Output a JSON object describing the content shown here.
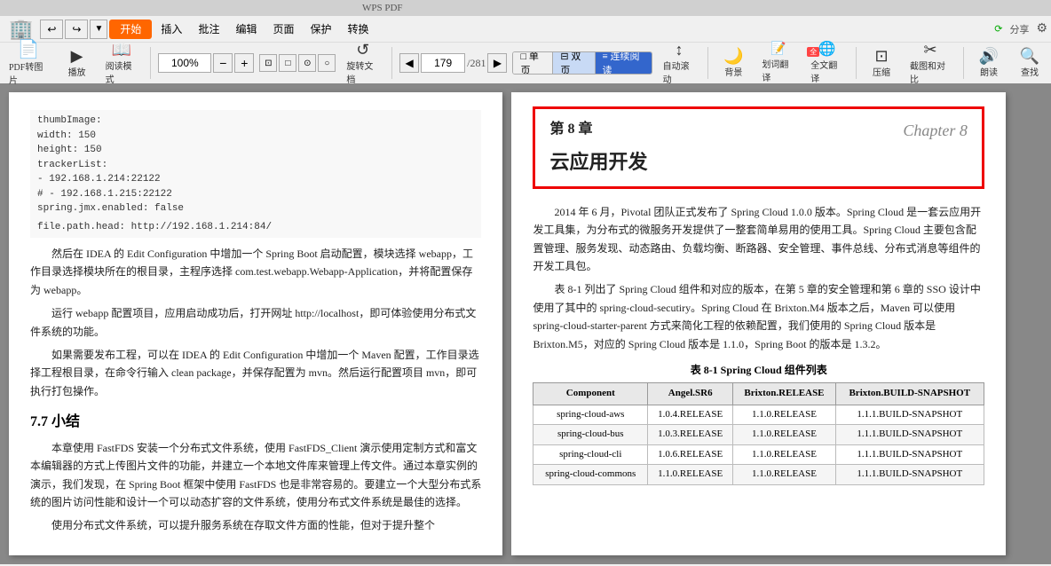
{
  "titlebar": {
    "text": ""
  },
  "toolbar": {
    "row1": {
      "buttons": [
        "↩",
        "↪",
        "▼"
      ],
      "start_label": "开始",
      "menus": [
        "插入",
        "批注",
        "编辑",
        "页面",
        "保护",
        "转换"
      ],
      "right_items": [
        "分享",
        "⚙"
      ]
    },
    "zoom": {
      "value": "100%",
      "total_pages": "281",
      "current_page": "179"
    },
    "buttons": [
      {
        "icon": "📄",
        "label": "PDF转图片"
      },
      {
        "icon": "▶",
        "label": "播放"
      },
      {
        "icon": "📖",
        "label": "阅读模式"
      },
      {
        "icon": "⊞",
        "label": ""
      },
      {
        "icon": "↺",
        "label": "旋转文档"
      },
      {
        "icon": "□",
        "label": "单页"
      },
      {
        "icon": "⊟",
        "label": "双页"
      },
      {
        "icon": "≡",
        "label": "连续阅读"
      },
      {
        "icon": "↕",
        "label": "自动滚动"
      },
      {
        "icon": "🌙",
        "label": "背景"
      },
      {
        "icon": "译",
        "label": "全文翻译"
      },
      {
        "icon": "⊡",
        "label": "压缩"
      },
      {
        "icon": "⊞",
        "label": "截图和对比"
      },
      {
        "icon": "🔊",
        "label": "朗读"
      },
      {
        "icon": "🔍",
        "label": "查找"
      },
      {
        "icon": "词",
        "label": "划词翻译"
      }
    ]
  },
  "left_page": {
    "code": [
      "  thumbImage:",
      "    width: 150",
      "    height: 150",
      "  trackerList:",
      "    - 192.168.1.214:22122",
      "#   - 192.168.1.215:22122",
      "spring.jmx.enabled: false",
      "",
      "file.path.head: http://192.168.1.214:84/"
    ],
    "paragraphs": [
      "然后在 IDEA 的 Edit Configuration 中增加一个 Spring Boot 启动配置，模块选择 webapp，工作目录选择模块所在的根目录，主程序选择 com.test.webapp.Webapp-Application，并将配置保存为 webapp。",
      "运行 webapp 配置项目，应用启动成功后，打开网址 http://localhost，即可体验使用分布式文件系统的功能。",
      "如果需要发布工程，可以在 IDEA 的 Edit Configuration 中增加一个 Maven 配置，工作目录选择工程根目录，在命令行输入 clean package，并保存配置为 mvn。然后运行配置项目 mvn，即可执行打包操作。"
    ],
    "section": "7.7  小结",
    "summary_paragraphs": [
      "本章使用 FastFDS 安装一个分布式文件系统，使用 FastFDS_Client 演示使用定制方式和富文本编辑器的方式上传图片文件的功能，并建立一个本地文件库来管理上传文件。通过本章实例的演示，我们发现，在 Spring Boot 框架中使用 FastFDS 也是非常容易的。要建立一个大型分布式系统的图片访问性能和设计一个可以动态扩容的文件系统，使用分布式文件系统是最佳的选择。",
      "使用分布式文件系统，可以提升服务系统在存取文件方面的性能，但对于提升整个"
    ]
  },
  "right_page": {
    "chapter_num": "第 8 章",
    "chapter_title_cn": "云应用开发",
    "chapter_title_en": "Chapter 8",
    "intro_paragraphs": [
      "2014 年 6 月，Pivotal 团队正式发布了 Spring Cloud 1.0.0 版本。Spring Cloud 是一套云应用开发工具集，为分布式的微服务开发提供了一整套简单易用的使用工具。Spring Cloud 主要包含配置管理、服务发现、动态路由、负载均衡、断路器、安全管理、事件总线、分布式消息等组件的开发工具包。",
      "表 8-1 列出了 Spring Cloud 组件和对应的版本，在第 5 章的安全管理和第 6 章的 SSO 设计中使用了其中的 spring-cloud-secutiry。Spring Cloud 在 Brixton.M4 版本之后，Maven 可以使用 spring-cloud-starter-parent 方式来简化工程的依赖配置，我们使用的 Spring Cloud 版本是 Brixton.M5，对应的 Spring Cloud 版本是 1.1.0，Spring Boot 的版本是 1.3.2。"
    ],
    "table": {
      "title": "表 8-1  Spring Cloud 组件列表",
      "headers": [
        "Component",
        "Angel.SR6",
        "Brixton.RELEASE",
        "Brixton.BUILD-SNAPSHOT"
      ],
      "rows": [
        [
          "spring-cloud-aws",
          "1.0.4.RELEASE",
          "1.1.0.RELEASE",
          "1.1.1.BUILD-SNAPSHOT"
        ],
        [
          "spring-cloud-bus",
          "1.0.3.RELEASE",
          "1.1.0.RELEASE",
          "1.1.1.BUILD-SNAPSHOT"
        ],
        [
          "spring-cloud-cli",
          "1.0.6.RELEASE",
          "1.1.0.RELEASE",
          "1.1.1.BUILD-SNAPSHOT"
        ],
        [
          "spring-cloud-...",
          "1.1.0.RELEASE",
          "1.1.0.RELEASE",
          "1.1.1.BUILD-SNAPSHOT"
        ]
      ]
    }
  }
}
